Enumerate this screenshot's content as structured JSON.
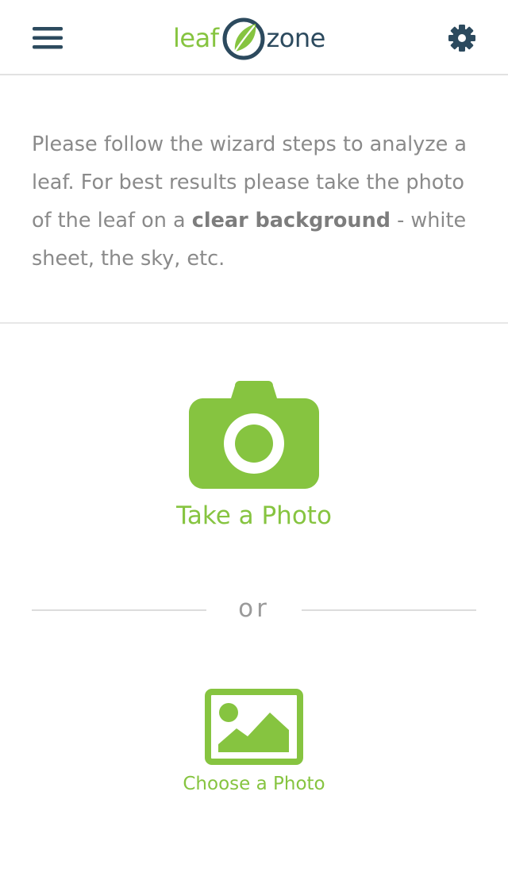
{
  "colors": {
    "brand_green": "#86c440",
    "brand_navy": "#2c4a5e",
    "text_gray": "#8a8a8a"
  },
  "header": {
    "menu_icon": "hamburger-menu-icon",
    "settings_icon": "gear-icon",
    "logo": {
      "part1": "leaf",
      "part2": "zone"
    }
  },
  "intro": {
    "text_before": "Please follow the wizard steps to analyze a leaf. For best results please take the photo of the leaf on a ",
    "emphasis": "clear background",
    "text_after": " - white sheet, the sky, etc."
  },
  "actions": {
    "take_photo": {
      "icon": "camera-icon",
      "label": "Take a Photo"
    },
    "separator": "or",
    "choose_photo": {
      "icon": "image-icon",
      "label": "Choose a Photo"
    }
  }
}
